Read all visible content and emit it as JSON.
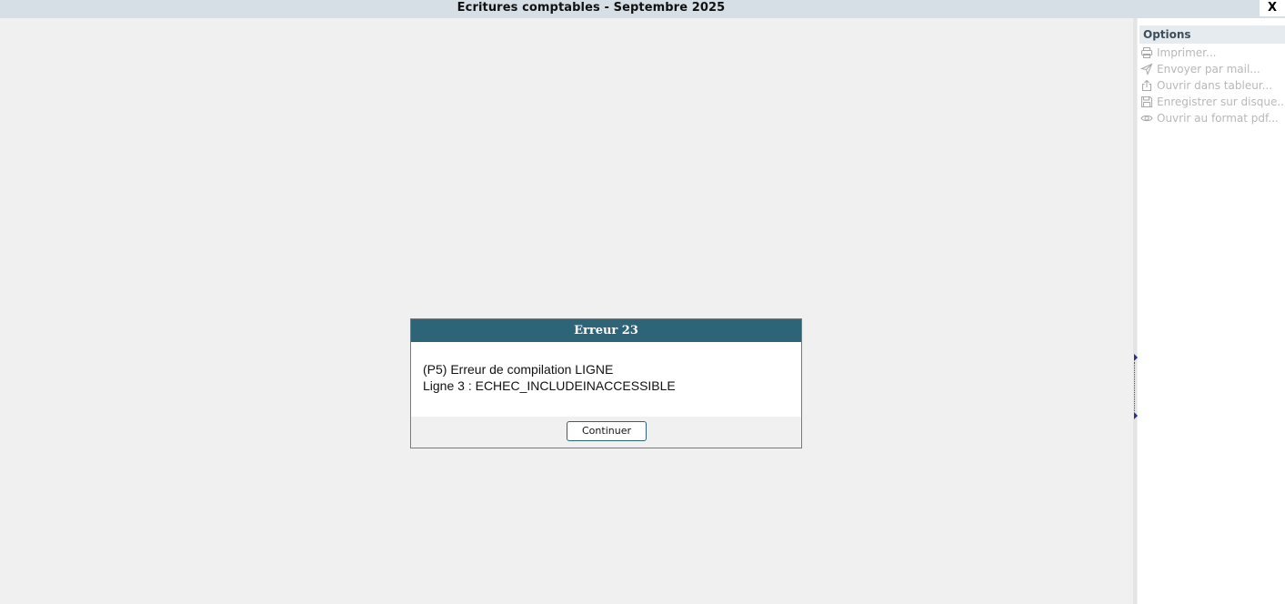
{
  "window": {
    "title": "Ecritures comptables - Septembre 2025",
    "close_label": "X"
  },
  "options": {
    "header": "Options",
    "items": [
      {
        "label": "Imprimer...",
        "icon": "printer-icon"
      },
      {
        "label": "Envoyer par mail...",
        "icon": "send-icon"
      },
      {
        "label": "Ouvrir dans tableur...",
        "icon": "share-icon"
      },
      {
        "label": "Enregistrer sur disque...",
        "icon": "floppy-disk-icon"
      },
      {
        "label": "Ouvrir au format pdf...",
        "icon": "eye-icon"
      }
    ],
    "disabled_color": "#b8b8b8"
  },
  "dialog": {
    "title": "Erreur 23",
    "line1": "(P5) Erreur de compilation LIGNE",
    "line2": "Ligne 3 : ECHEC_INCLUDEINACCESSIBLE",
    "button_label": "Continuer",
    "header_color": "#2e6478"
  }
}
